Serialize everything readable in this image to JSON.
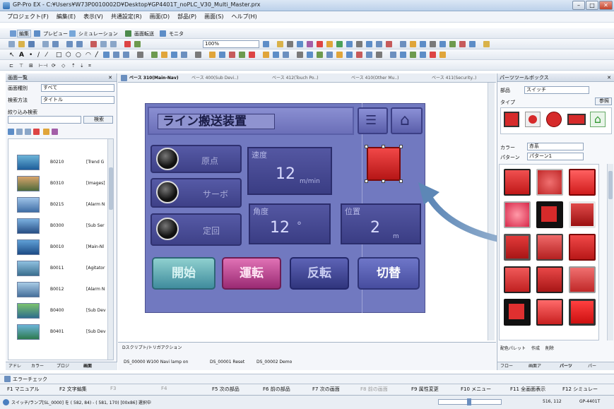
{
  "window": {
    "title": "GP-Pro EX - C:¥Users¥W73P0010002D¥Desktop¥GP4401T_noPLC_V30_Multi_Master.prx"
  },
  "menu": [
    "プロジェクト(F)",
    "編集(E)",
    "表示(V)",
    "共通設定(R)",
    "画面(D)",
    "部品(P)",
    "画面(S)",
    "ヘルプ(H)"
  ],
  "toolbar1": {
    "edit": "編集",
    "preview": "プレビュー",
    "simulation": "シミュレーション",
    "transfer": "画面転送",
    "monitor": "モニタ"
  },
  "toolbar2": {
    "zoom": "100%"
  },
  "left_panel": {
    "title": "画面一覧",
    "type_label": "画面種別",
    "type_value": "すべて",
    "search_label": "検索方法",
    "search_value": "タイトル",
    "narrow_label": "絞り込み検索",
    "narrow_button": "検索",
    "items": [
      {
        "no": "B0210",
        "name": "[Trend G"
      },
      {
        "no": "B0310",
        "name": "[Images]"
      },
      {
        "no": "B0215",
        "name": "[Alarm N"
      },
      {
        "no": "B0300",
        "name": "[Sub Ser"
      },
      {
        "no": "B0010",
        "name": "[Main-Nl"
      },
      {
        "no": "B0011",
        "name": "[Agitator"
      },
      {
        "no": "B0012",
        "name": "[Alarm N"
      },
      {
        "no": "B0400",
        "name": "[Sub Dev"
      },
      {
        "no": "B0401",
        "name": "[Sub Dev"
      }
    ],
    "bottom_tabs": [
      "アドレ",
      "カラー",
      "プロジ",
      "画面"
    ]
  },
  "tabs": [
    {
      "label": "ベース 310(Main-Nav)",
      "active": true
    },
    {
      "label": "ベース 400(Sub Devi..)",
      "active": false
    },
    {
      "label": "ベース 412(Touch Po..)",
      "active": false
    },
    {
      "label": "ベース 410(Other Mu..)",
      "active": false
    },
    {
      "label": "ベース 411(Security..)",
      "active": false
    }
  ],
  "hmi": {
    "title": "ライン搬送装置",
    "lamps": [
      "原点",
      "サーボ",
      "定回"
    ],
    "speed": {
      "caption": "速度",
      "value": "12",
      "unit": "m/min"
    },
    "angle": {
      "caption": "角度",
      "value": "12",
      "unit": "°"
    },
    "position": {
      "caption": "位置",
      "value": "2",
      "unit": "m"
    },
    "buttons": [
      "開始",
      "運転",
      "反転",
      "切替"
    ]
  },
  "script_panel": {
    "title": "Dスクリプト/トリガアクション",
    "items": [
      "DS_00000 W100 Navi lamp on",
      "DS_00001 Reset",
      "DS_00002 Demo"
    ]
  },
  "error_check": "エラーチェック",
  "right_panel": {
    "title": "パーツツールボックス",
    "parts_label": "部品",
    "parts_value": "スイッチ",
    "type_label": "タイプ",
    "ref_button": "参照",
    "color_label": "カラー",
    "color_value": "赤系",
    "pattern_label": "パターン",
    "pattern_value": "パターン1",
    "bottom_links": [
      "配色パレット",
      "作成",
      "削除"
    ],
    "bottom_tabs": [
      "フロー",
      "画面ア",
      "パーツ",
      "パー"
    ]
  },
  "fkeys": [
    {
      "key": "F1",
      "label": "マニュアル"
    },
    {
      "key": "F2",
      "label": "文字編集"
    },
    {
      "key": "F3",
      "label": ""
    },
    {
      "key": "F4",
      "label": ""
    },
    {
      "key": "F5",
      "label": "次の部品"
    },
    {
      "key": "F6",
      "label": "前の部品"
    },
    {
      "key": "F7",
      "label": "次の画面"
    },
    {
      "key": "F8",
      "label": "前の画面"
    },
    {
      "key": "F9",
      "label": "属性変更"
    },
    {
      "key": "F10",
      "label": "メニュー"
    },
    {
      "key": "F11",
      "label": "全画面表示"
    },
    {
      "key": "F12",
      "label": "シミュレー"
    }
  ],
  "status": {
    "left": "スイッチ/ランプ[SL_0000] を ( 582, 84) - ( 581, 170) [00x86] 選択中",
    "coords": "516, 112",
    "model": "GP-4401T"
  },
  "colors": {
    "accent": "#7179c0",
    "red": "#d62a2a",
    "frame": "#4d5290"
  }
}
